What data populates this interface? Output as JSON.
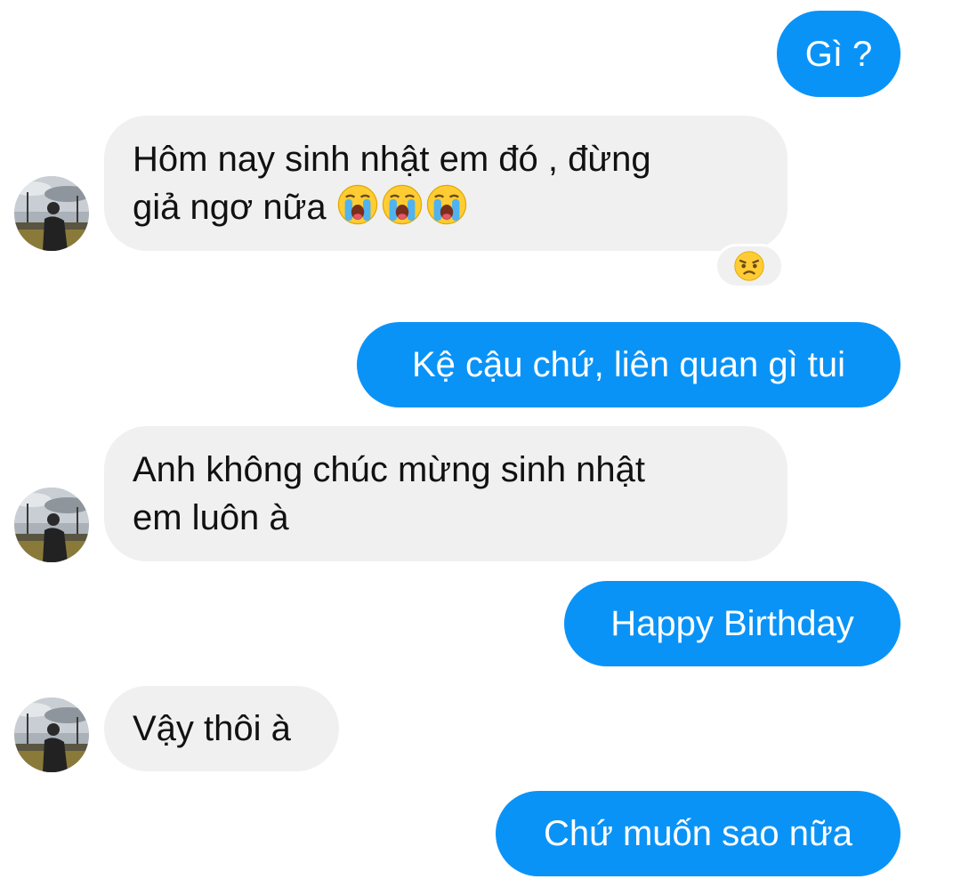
{
  "colors": {
    "outgoing_bubble": "#0a93f7",
    "incoming_bubble": "#f0f0f0",
    "emoji_face": "#ffcc33"
  },
  "messages": [
    {
      "direction": "outgoing",
      "text": "Gì ?"
    },
    {
      "direction": "incoming",
      "line1": "Hôm nay sinh nhật em đó , đừng",
      "line2": "giả ngơ nữa",
      "emojis": [
        "loudly-crying-face-icon",
        "loudly-crying-face-icon",
        "loudly-crying-face-icon"
      ],
      "reaction": "angry-face-icon"
    },
    {
      "direction": "outgoing",
      "text": "Kệ cậu chứ, liên quan gì tui"
    },
    {
      "direction": "incoming",
      "line1": "Anh không chúc mừng sinh nhật",
      "line2": "em luôn à"
    },
    {
      "direction": "outgoing",
      "text": "Happy Birthday"
    },
    {
      "direction": "incoming",
      "text": "Vậy thôi à"
    },
    {
      "direction": "outgoing",
      "text": "Chứ muốn sao nữa"
    }
  ]
}
